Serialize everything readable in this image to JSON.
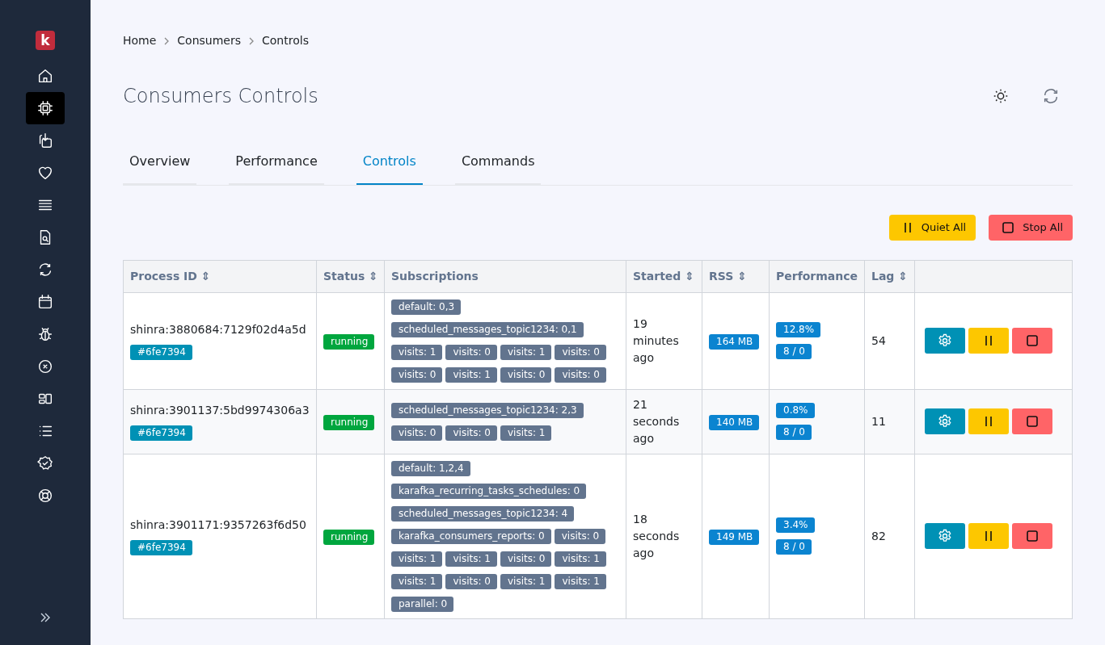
{
  "sidebar": {
    "logo": "k",
    "items": [
      {
        "selected": false
      },
      {
        "selected": true
      },
      {
        "selected": false
      },
      {
        "selected": false
      },
      {
        "selected": false
      },
      {
        "selected": false
      },
      {
        "selected": false
      },
      {
        "selected": false
      },
      {
        "selected": false
      },
      {
        "selected": false
      },
      {
        "selected": false
      },
      {
        "selected": false
      },
      {
        "selected": false
      },
      {
        "selected": false
      }
    ]
  },
  "breadcrumb": [
    "Home",
    "Consumers",
    "Controls"
  ],
  "page_title": "Consumers Controls",
  "tabs": [
    {
      "label": "Overview",
      "selected": false
    },
    {
      "label": "Performance",
      "selected": false
    },
    {
      "label": "Controls",
      "selected": true
    },
    {
      "label": "Commands",
      "selected": false
    }
  ],
  "bulk_actions": [
    {
      "label": "Quiet All",
      "kind": "quiet"
    },
    {
      "label": "Stop All",
      "kind": "stop"
    }
  ],
  "table": {
    "columns": [
      {
        "label": "Process ID",
        "sort_icon": "⇕"
      },
      {
        "label": "Status",
        "sort_icon": "⇕"
      },
      {
        "label": "Subscriptions"
      },
      {
        "label": "Started",
        "sort_icon": "⇕"
      },
      {
        "label": "RSS",
        "sort_icon": "⇕"
      },
      {
        "label": "Performance"
      },
      {
        "label": "Lag",
        "sort_icon": "⇕"
      },
      {}
    ],
    "rows": [
      {
        "process_id": "shinra:3880684:7129f02d4a5d",
        "tag": "#6fe7394",
        "status": "running",
        "subscriptions": [
          "default: 0,3",
          "scheduled_messages_topic1234: 0,1",
          "visits: 1",
          "visits: 0",
          "visits: 1",
          "visits: 0",
          "visits: 0",
          "visits: 1",
          "visits: 0",
          "visits: 0"
        ],
        "started": "19 minutes ago",
        "rss": "164 MB",
        "performance": [
          "12.8%",
          "8 / 0"
        ],
        "lag": "54"
      },
      {
        "process_id": "shinra:3901137:5bd9974306a3",
        "tag": "#6fe7394",
        "status": "running",
        "subscriptions": [
          "scheduled_messages_topic1234: 2,3",
          "visits: 0",
          "visits: 0",
          "visits: 1"
        ],
        "started": "21 seconds ago",
        "rss": "140 MB",
        "performance": [
          "0.8%",
          "8 / 0"
        ],
        "lag": "11"
      },
      {
        "process_id": "shinra:3901171:9357263f6d50",
        "tag": "#6fe7394",
        "status": "running",
        "subscriptions": [
          "default: 1,2,4",
          "karafka_recurring_tasks_schedules: 0",
          "scheduled_messages_topic1234: 4",
          "karafka_consumers_reports: 0",
          "visits: 0",
          "visits: 1",
          "visits: 1",
          "visits: 0",
          "visits: 1",
          "visits: 1",
          "visits: 0",
          "visits: 1",
          "visits: 1",
          "parallel: 0"
        ],
        "started": "18 seconds ago",
        "rss": "149 MB",
        "performance": [
          "3.4%",
          "8 / 0"
        ],
        "lag": "82"
      }
    ]
  }
}
